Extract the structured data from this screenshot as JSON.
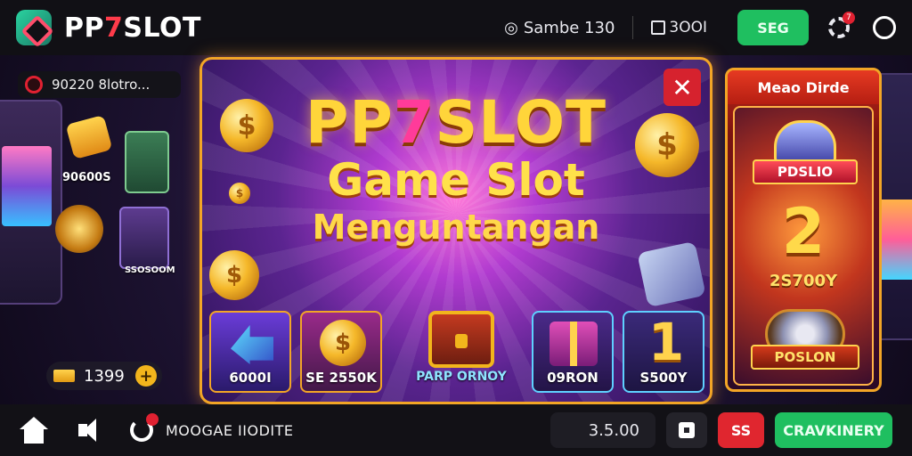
{
  "header": {
    "brand_prefix": "PP",
    "brand_seven": "7",
    "brand_suffix": "SLOT",
    "user_text": "Sambe 130",
    "wallet_text": "3OOI",
    "seg_label": "SEG",
    "notification_count": "7"
  },
  "lobby": {
    "promo_text": "90220 8lotro...",
    "tile_label_1": "90600S",
    "tile_label_2": "SSOSOOM",
    "balance": "1399",
    "plus": "+"
  },
  "modal": {
    "close": "✕",
    "title_prefix": "PP",
    "title_seven": "7",
    "title_suffix": "SLOT",
    "subtitle": "Game Slot",
    "subtitle2": "Menguntangan",
    "coin_symbol": "$",
    "cards": [
      {
        "label": "6000I"
      },
      {
        "label": "SE 2550K"
      },
      {
        "label": "PARP ORNOY"
      },
      {
        "label": "09RON"
      },
      {
        "label": "S500Y"
      }
    ],
    "card5_number": "1"
  },
  "side_panel": {
    "header": "Meao Dirde",
    "ribbon_top": "PDSLIO",
    "big_number": "2",
    "value": "2S700Y",
    "ribbon_bottom": "POSLON"
  },
  "footer": {
    "mode_label": "MOOGAE IIODITE",
    "amount": "3.5.00",
    "ss_label": "SS",
    "cta_label": "CRAVKINERY"
  },
  "colors": {
    "accent_green": "#1fbf60",
    "accent_red": "#e0262f",
    "gold": "#f2a526"
  },
  "icons": [
    "logo-icon",
    "user-icon",
    "wallet-icon",
    "gear-icon",
    "circle-icon",
    "shield-icon",
    "coin-icon",
    "plus-icon",
    "close-icon",
    "home-icon",
    "sound-icon",
    "refresh-icon",
    "cart-icon"
  ]
}
